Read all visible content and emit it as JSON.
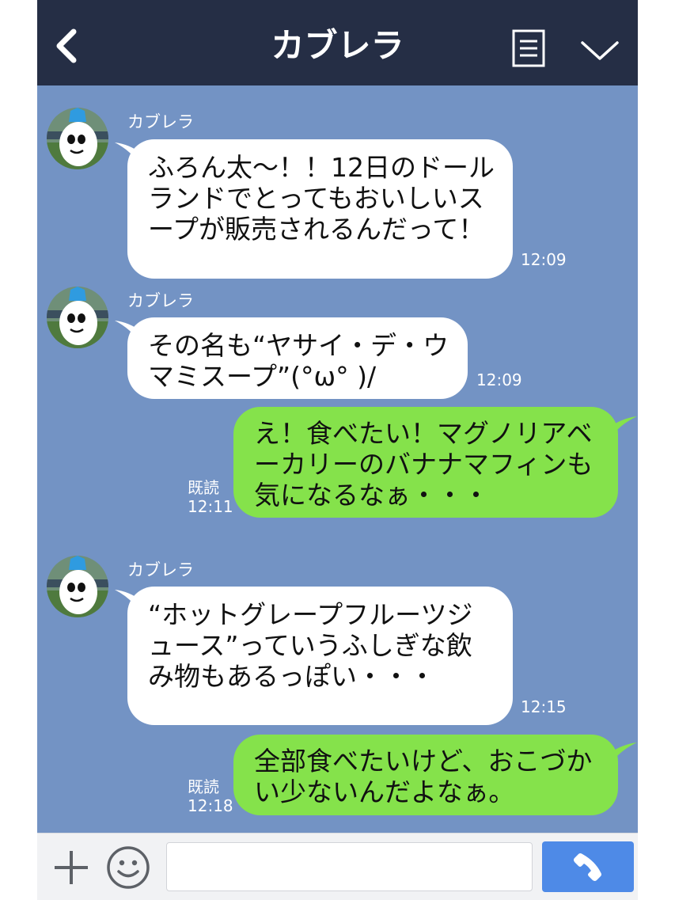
{
  "header": {
    "title": "カブレラ",
    "back_icon": "chevron-left-icon",
    "menu_icon": "list-menu-icon",
    "collapse_icon": "chevron-down-icon"
  },
  "messages": [
    {
      "type": "in",
      "sender": "カブレラ",
      "text": "ふろん太〜！！12日のドールランドでとってもおいしいスープが販売されるんだって！",
      "time": "12:09"
    },
    {
      "type": "in",
      "sender": "カブレラ",
      "text": "その名も“ヤサイ・デ・ウマミスープ”(°ω° )/",
      "time": "12:09"
    },
    {
      "type": "out",
      "read": "既読",
      "text": "え！食べたい！マグノリアベーカリーのバナナマフィンも気になるなぁ・・・",
      "time": "12:11"
    },
    {
      "type": "in",
      "sender": "カブレラ",
      "text": "“ホットグレープフルーツジュース”っていうふしぎな飲み物もあるっぽい・・・",
      "time": "12:15"
    },
    {
      "type": "out",
      "read": "既読",
      "text": "全部食べたいけど、おこづかい少ないんだよなぁ。",
      "time": "12:18"
    }
  ],
  "input_bar": {
    "plus_icon": "plus-icon",
    "emoji_icon": "smiley-icon",
    "message_placeholder": "",
    "call_icon": "phone-icon"
  },
  "colors": {
    "header_bg": "#252e45",
    "chat_bg": "#7393c4",
    "outgoing_bubble": "#85e24b",
    "incoming_bubble": "#ffffff",
    "call_button": "#4e8ae7"
  }
}
